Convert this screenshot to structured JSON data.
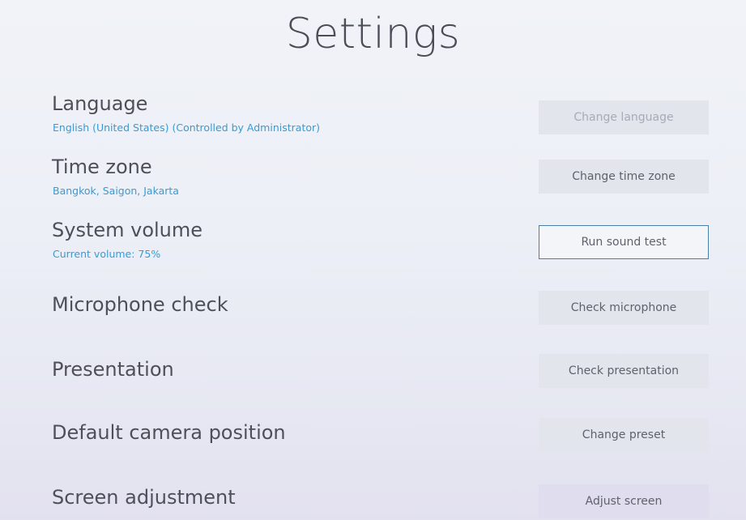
{
  "title": "Settings",
  "settings": [
    {
      "label": "Language",
      "detail": "English (United States) (Controlled by Administrator)",
      "button": "Change language",
      "state": "disabled"
    },
    {
      "label": "Time zone",
      "detail": "Bangkok, Saigon, Jakarta",
      "button": "Change time zone",
      "state": "normal"
    },
    {
      "label": "System volume",
      "detail": "Current volume: 75%",
      "button": "Run sound test",
      "state": "focused"
    },
    {
      "label": "Microphone check",
      "button": "Check microphone",
      "state": "normal"
    },
    {
      "label": "Presentation",
      "button": "Check presentation",
      "state": "normal"
    },
    {
      "label": "Default camera position",
      "button": "Change preset",
      "state": "normal"
    },
    {
      "label": "Screen adjustment",
      "button": "Adjust screen",
      "state": "normal"
    }
  ],
  "colors": {
    "title_text": "#4a4d57",
    "detail_text": "#3b9ad2",
    "button_bg": "#e3e5ec",
    "focus_border": "#4a7fa8"
  }
}
